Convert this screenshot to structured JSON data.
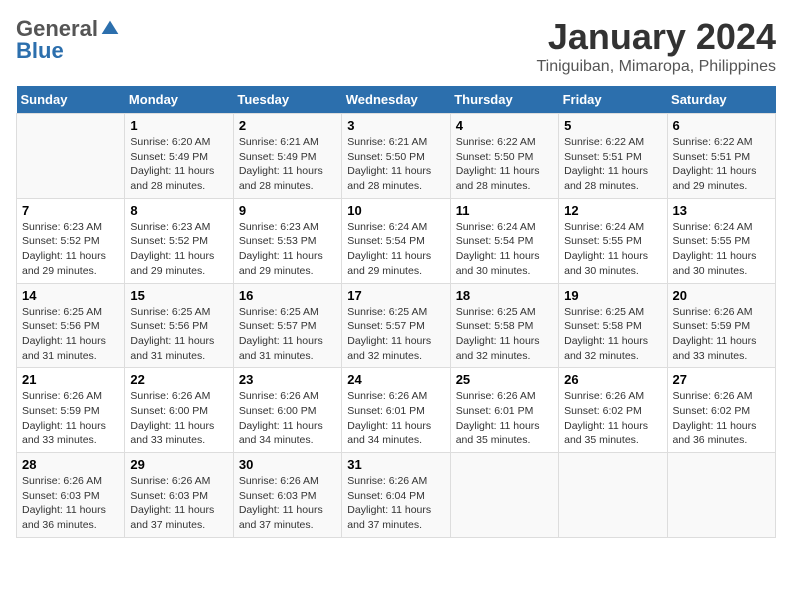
{
  "header": {
    "logo": {
      "general": "General",
      "blue": "Blue"
    },
    "title": "January 2024",
    "subtitle": "Tiniguiban, Mimaropa, Philippines"
  },
  "calendar": {
    "days_of_week": [
      "Sunday",
      "Monday",
      "Tuesday",
      "Wednesday",
      "Thursday",
      "Friday",
      "Saturday"
    ],
    "weeks": [
      [
        {
          "day": "",
          "sunrise": "",
          "sunset": "",
          "daylight": ""
        },
        {
          "day": "1",
          "sunrise": "6:20 AM",
          "sunset": "5:49 PM",
          "daylight": "11 hours and 28 minutes."
        },
        {
          "day": "2",
          "sunrise": "6:21 AM",
          "sunset": "5:49 PM",
          "daylight": "11 hours and 28 minutes."
        },
        {
          "day": "3",
          "sunrise": "6:21 AM",
          "sunset": "5:50 PM",
          "daylight": "11 hours and 28 minutes."
        },
        {
          "day": "4",
          "sunrise": "6:22 AM",
          "sunset": "5:50 PM",
          "daylight": "11 hours and 28 minutes."
        },
        {
          "day": "5",
          "sunrise": "6:22 AM",
          "sunset": "5:51 PM",
          "daylight": "11 hours and 28 minutes."
        },
        {
          "day": "6",
          "sunrise": "6:22 AM",
          "sunset": "5:51 PM",
          "daylight": "11 hours and 29 minutes."
        }
      ],
      [
        {
          "day": "7",
          "sunrise": "6:23 AM",
          "sunset": "5:52 PM",
          "daylight": "11 hours and 29 minutes."
        },
        {
          "day": "8",
          "sunrise": "6:23 AM",
          "sunset": "5:52 PM",
          "daylight": "11 hours and 29 minutes."
        },
        {
          "day": "9",
          "sunrise": "6:23 AM",
          "sunset": "5:53 PM",
          "daylight": "11 hours and 29 minutes."
        },
        {
          "day": "10",
          "sunrise": "6:24 AM",
          "sunset": "5:54 PM",
          "daylight": "11 hours and 29 minutes."
        },
        {
          "day": "11",
          "sunrise": "6:24 AM",
          "sunset": "5:54 PM",
          "daylight": "11 hours and 30 minutes."
        },
        {
          "day": "12",
          "sunrise": "6:24 AM",
          "sunset": "5:55 PM",
          "daylight": "11 hours and 30 minutes."
        },
        {
          "day": "13",
          "sunrise": "6:24 AM",
          "sunset": "5:55 PM",
          "daylight": "11 hours and 30 minutes."
        }
      ],
      [
        {
          "day": "14",
          "sunrise": "6:25 AM",
          "sunset": "5:56 PM",
          "daylight": "11 hours and 31 minutes."
        },
        {
          "day": "15",
          "sunrise": "6:25 AM",
          "sunset": "5:56 PM",
          "daylight": "11 hours and 31 minutes."
        },
        {
          "day": "16",
          "sunrise": "6:25 AM",
          "sunset": "5:57 PM",
          "daylight": "11 hours and 31 minutes."
        },
        {
          "day": "17",
          "sunrise": "6:25 AM",
          "sunset": "5:57 PM",
          "daylight": "11 hours and 32 minutes."
        },
        {
          "day": "18",
          "sunrise": "6:25 AM",
          "sunset": "5:58 PM",
          "daylight": "11 hours and 32 minutes."
        },
        {
          "day": "19",
          "sunrise": "6:25 AM",
          "sunset": "5:58 PM",
          "daylight": "11 hours and 32 minutes."
        },
        {
          "day": "20",
          "sunrise": "6:26 AM",
          "sunset": "5:59 PM",
          "daylight": "11 hours and 33 minutes."
        }
      ],
      [
        {
          "day": "21",
          "sunrise": "6:26 AM",
          "sunset": "5:59 PM",
          "daylight": "11 hours and 33 minutes."
        },
        {
          "day": "22",
          "sunrise": "6:26 AM",
          "sunset": "6:00 PM",
          "daylight": "11 hours and 33 minutes."
        },
        {
          "day": "23",
          "sunrise": "6:26 AM",
          "sunset": "6:00 PM",
          "daylight": "11 hours and 34 minutes."
        },
        {
          "day": "24",
          "sunrise": "6:26 AM",
          "sunset": "6:01 PM",
          "daylight": "11 hours and 34 minutes."
        },
        {
          "day": "25",
          "sunrise": "6:26 AM",
          "sunset": "6:01 PM",
          "daylight": "11 hours and 35 minutes."
        },
        {
          "day": "26",
          "sunrise": "6:26 AM",
          "sunset": "6:02 PM",
          "daylight": "11 hours and 35 minutes."
        },
        {
          "day": "27",
          "sunrise": "6:26 AM",
          "sunset": "6:02 PM",
          "daylight": "11 hours and 36 minutes."
        }
      ],
      [
        {
          "day": "28",
          "sunrise": "6:26 AM",
          "sunset": "6:03 PM",
          "daylight": "11 hours and 36 minutes."
        },
        {
          "day": "29",
          "sunrise": "6:26 AM",
          "sunset": "6:03 PM",
          "daylight": "11 hours and 37 minutes."
        },
        {
          "day": "30",
          "sunrise": "6:26 AM",
          "sunset": "6:03 PM",
          "daylight": "11 hours and 37 minutes."
        },
        {
          "day": "31",
          "sunrise": "6:26 AM",
          "sunset": "6:04 PM",
          "daylight": "11 hours and 37 minutes."
        },
        {
          "day": "",
          "sunrise": "",
          "sunset": "",
          "daylight": ""
        },
        {
          "day": "",
          "sunrise": "",
          "sunset": "",
          "daylight": ""
        },
        {
          "day": "",
          "sunrise": "",
          "sunset": "",
          "daylight": ""
        }
      ]
    ]
  }
}
